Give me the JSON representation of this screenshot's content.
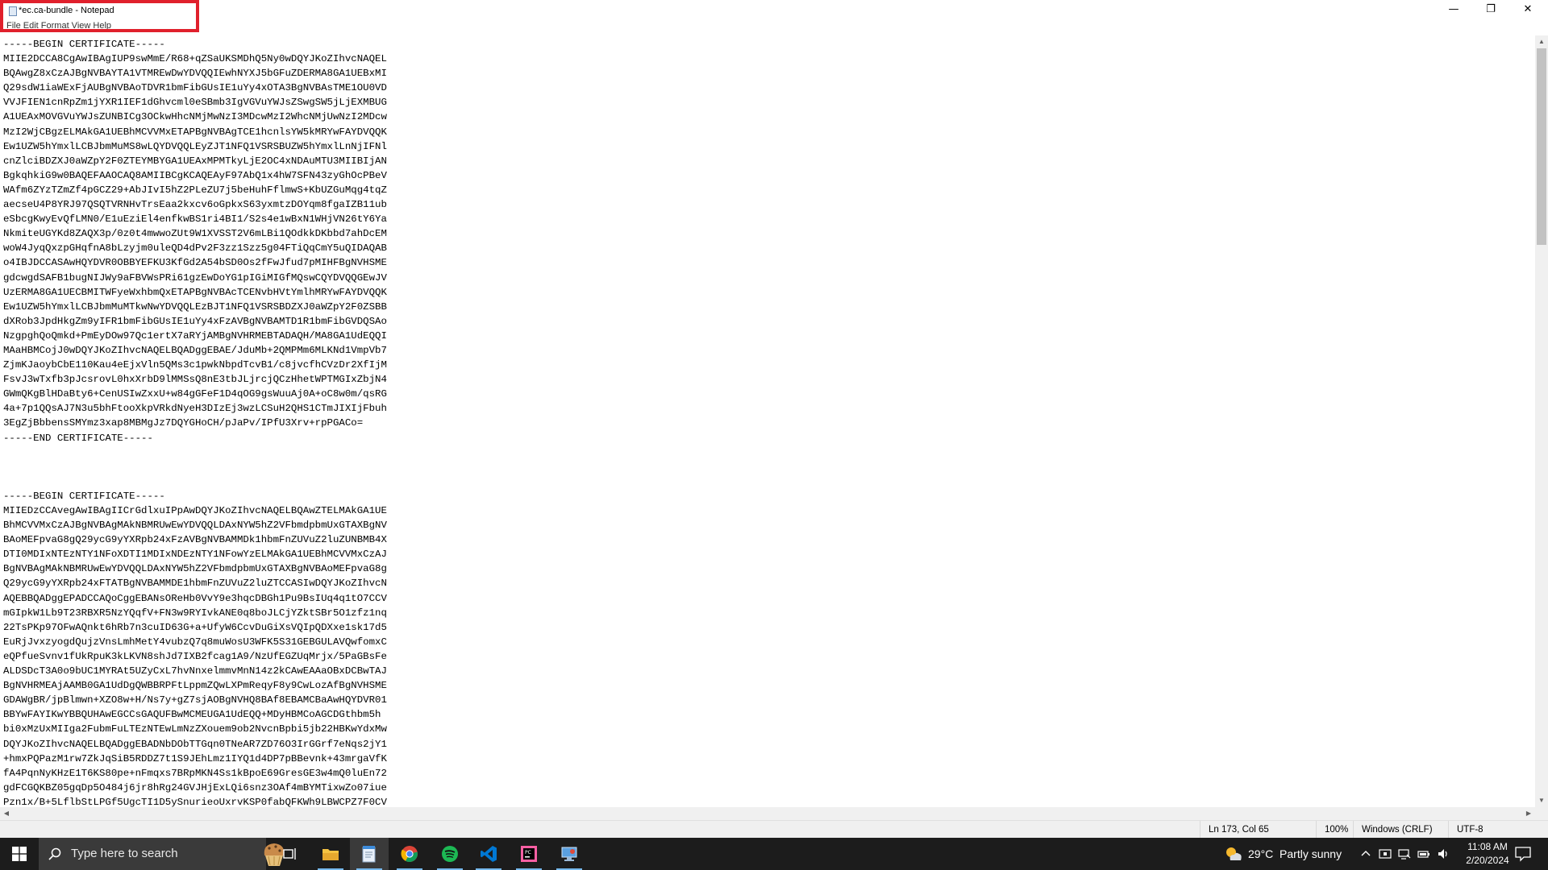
{
  "window": {
    "title": "*ec.ca-bundle - Notepad",
    "menu_peek": "File  Edit  Format  View  Help",
    "controls": {
      "minimize": "—",
      "maximize": "❐",
      "close": "✕"
    }
  },
  "editor": {
    "blocks": [
      {
        "begin": "-----BEGIN CERTIFICATE-----",
        "lines": [
          "MIIE2DCCA8CgAwIBAgIUP9swMmE/R68+qZSaUKSMDhQ5Ny0wDQYJKoZIhvcNAQEL",
          "BQAwgZ8xCzAJBgNVBAYTA1VTMREwDwYDVQQIEwhNYXJ5bGFuZDERMA8GA1UEBxMI",
          "Q29sdW1iaWExFjAUBgNVBAoTDVR1bmFibGUsIE1uYy4xOTA3BgNVBAsTME1OU0VD",
          "VVJFIEN1cnRpZm1jYXR1IEF1dGhvcml0eSBmb3IgVGVuYWJsZSwgSW5jLjEXMBUG",
          "A1UEAxMOVGVuYWJsZUNBICg3OCkwHhcNMjMwNzI3MDcwMzI2WhcNMjUwNzI2MDcw",
          "MzI2WjCBgzELMAkGA1UEBhMCVVMxETAPBgNVBAgTCE1hcnlsYW5kMRYwFAYDVQQK",
          "Ew1UZW5hYmxlLCBJbmMuMS8wLQYDVQQLEyZJT1NFQ1VSRSBUZW5hYmxlLnNjIFNl",
          "cnZlciBDZXJ0aWZpY2F0ZTEYMBYGA1UEAxMPMTkyLjE2OC4xNDAuMTU3MIIBIjAN",
          "BgkqhkiG9w0BAQEFAAOCAQ8AMIIBCgKCAQEAyF97AbQ1x4hW7SFN43zyGhOcPBeV",
          "WAfm6ZYzTZmZf4pGCZ29+AbJIvI5hZ2PLeZU7j5beHuhFflmwS+KbUZGuMqg4tqZ",
          "aecseU4P8YRJ97QSQTVRNHvTrsEaa2kxcv6oGpkxS63yxmtzDOYqm8fgaIZB11ub",
          "eSbcgKwyEvQfLMN0/E1uEziEl4enfkwBS1ri4BI1/S2s4e1wBxN1WHjVN26tY6Ya",
          "NkmiteUGYKd8ZAQX3p/0z0t4mwwoZUt9W1XVSST2V6mLBi1QOdkkDKbbd7ahDcEM",
          "woW4JyqQxzpGHqfnA8bLzyjm0uleQD4dPv2F3zz1Szz5g04FTiQqCmY5uQIDAQAB",
          "o4IBJDCCASAwHQYDVR0OBBYEFKU3KfGd2A54bSD0Os2fFwJfud7pMIHFBgNVHSME",
          "gdcwgdSAFB1bugNIJWy9aFBVWsPRi61gzEwDoYG1pIGiMIGfMQswCQYDVQQGEwJV",
          "UzERMA8GA1UECBMITWFyeWxhbmQxETAPBgNVBAcTCENvbHVtYmlhMRYwFAYDVQQK",
          "Ew1UZW5hYmxlLCBJbmMuMTkwNwYDVQQLEzBJT1NFQ1VSRSBDZXJ0aWZpY2F0ZSBB",
          "dXRob3JpdHkgZm9yIFR1bmFibGUsIE1uYy4xFzAVBgNVBAMTD1R1bmFibGVDQSAo",
          "NzgpghQoQmkd+PmEyDOw97Qc1ertX7aRYjAMBgNVHRMEBTADAQH/MA8GA1UdEQQI",
          "MAaHBMCojJ0wDQYJKoZIhvcNAQELBQADggEBAE/JduMb+2QMPMm6MLKNd1VmpVb7",
          "ZjmKJaoybCbE110Kau4eEjxVln5QMs3c1pwkNbpdTcvB1/c8jvcfhCVzDr2XfIjM",
          "FsvJ3wTxfb3pJcsrovL0hxXrbD9lMMSsQ8nE3tbJLjrcjQCzHhetWPTMGIxZbjN4",
          "GWmQKgBlHDaBty6+CenUSIwZxxU+w84gGFeF1D4qOG9gsWuuAj0A+oC8w0m/qsRG",
          "4a+7p1QQsAJ7N3u5bhFtooXkpVRkdNyeH3DIzEj3wzLCSuH2QHS1CTmJIXIjFbuh",
          "3EgZjBbbensSMYmz3xap8MBMgJz7DQYGHoCH/pJaPv/IPfU3Xrv+rpPGACo="
        ],
        "end": "-----END CERTIFICATE-----"
      },
      {
        "begin": "-----BEGIN CERTIFICATE-----",
        "lines": [
          "MIIEDzCCAvegAwIBAgIICrGdlxuIPpAwDQYJKoZIhvcNAQELBQAwZTELMAkGA1UE",
          "BhMCVVMxCzAJBgNVBAgMAkNBMRUwEwYDVQQLDAxNYW5hZ2VFbmdpbmUxGTAXBgNV",
          "BAoMEFpvaG8gQ29ycG9yYXRpb24xFzAVBgNVBAMMDk1hbmFnZUVuZ2luZUNBMB4X",
          "DTI0MDIxNTEzNTY1NFoXDTI1MDIxNDEzNTY1NFowYzELMAkGA1UEBhMCVVMxCzAJ",
          "BgNVBAgMAkNBMRUwEwYDVQQLDAxNYW5hZ2VFbmdpbmUxGTAXBgNVBAoMEFpvaG8g",
          "Q29ycG9yYXRpb24xFTATBgNVBAMMDE1hbmFnZUVuZ2luZTCCASIwDQYJKoZIhvcN",
          "AQEBBQADggEPADCCAQoCggEBANsOReHb0VvY9e3hqcDBGh1Pu9BsIUq4q1tO7CCV",
          "mGIpkW1Lb9T23RBXR5NzYQqfV+FN3w9RYIvkANE0q8boJLCjYZktSBr5O1zfz1nq",
          "22TsPKp97OFwAQnkt6hRb7n3cuID63G+a+UfyW6CcvDuGiXsVQIpQDXxe1sk17d5",
          "EuRjJvxzyogdQujzVnsLmhMetY4vubzQ7q8muWosU3WFK5S31GEBGULAVQwfomxC",
          "eQPfueSvnv1fUkRpuK3kLKVN8shJd7IXB2fcag1A9/NzUfEGZUqMrjx/5PaGBsFe",
          "ALDSDcT3A0o9bUC1MYRAt5UZyCxL7hvNnxelmmvMnN14z2kCAwEAAaOBxDCBwTAJ",
          "BgNVHRMEAjAAMB0GA1UdDgQWBBRPFtLppmZQwLXPmReqyF8y9CwLozAfBgNVHSME",
          "GDAWgBR/jpBlmwn+XZO8w+H/Ns7y+gZ7sjAOBgNVHQ8BAf8EBAMCBaAwHQYDVR01",
          "BBYwFAYIKwYBBQUHAwEGCCsGAQUFBwMCMEUGA1UdEQQ+MDyHBMCoAGCDGthbm5h",
          "bi0xMzUxMIIga2FubmFuLTEzNTEwLmNzZXouem9ob2NvcnBpbi5jb22HBKwYdxMw",
          "DQYJKoZIhvcNAQELBQADggEBADNbDObTTGqn0TNeAR7ZD76O3IrGGrf7eNqs2jY1",
          "+hmxPQPazM1rw7ZkJqSiB5RDDZ7t1S9JEhLmz1IYQ1d4DP7pBBevnk+43mrgaVfK",
          "fA4PqnNyKHzE1T6KS80pe+nFmqxs7BRpMKN4Ss1kBpoE69GresGE3w4mQ0luEn72",
          "gdFCGQKBZ05gqDp5O484j6jr8hRg24GVJHjExLQi6snz3OAf4mBYMTixwZo07iue",
          "Pzn1x/B+5LflbStLPGf5UgcTI1D5ySnurieoUxrvKSP0fabQFKWh9LBWCPZ7F0CV"
        ]
      }
    ]
  },
  "status_bar": {
    "position": "Ln 173, Col 65",
    "zoom": "100%",
    "line_endings": "Windows (CRLF)",
    "encoding": "UTF-8"
  },
  "taskbar": {
    "search_placeholder": "Type here to search",
    "apps": [
      {
        "icon": "task-view-icon",
        "active": false
      },
      {
        "icon": "file-explorer-icon",
        "active": false
      },
      {
        "icon": "notepad-icon",
        "active": true
      },
      {
        "icon": "chrome-icon",
        "active": false
      },
      {
        "icon": "spotify-icon",
        "active": false
      },
      {
        "icon": "vscode-icon",
        "active": false
      },
      {
        "icon": "jetbrains-icon",
        "active": false
      },
      {
        "icon": "remote-desktop-icon",
        "active": false
      }
    ],
    "weather": "29°C  Partly sunny",
    "time": "11:08 AM",
    "date": "2/20/2024",
    "colors": {
      "accent_underline": "#76b9ed",
      "title_highlight": "#e0202c",
      "spotify": "#1db954",
      "vscode": "#0078d4"
    }
  }
}
